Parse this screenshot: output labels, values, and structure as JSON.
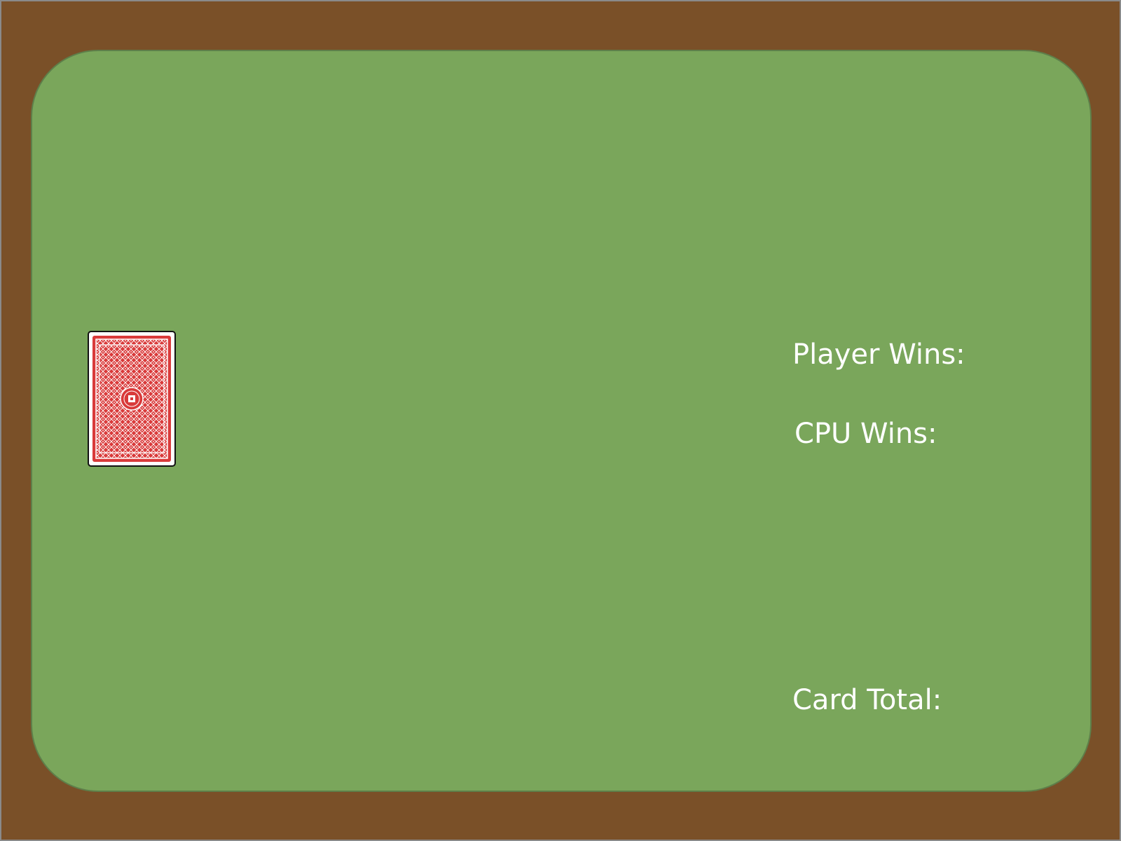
{
  "colors": {
    "frame": "#7a5028",
    "felt": "#7aa65b",
    "card_back": "#d93a3a",
    "label_text": "#ffffff"
  },
  "deck": {
    "icon": "card-back-icon"
  },
  "scoreboard": {
    "player_wins_label": "Player Wins:",
    "cpu_wins_label": "CPU Wins:"
  },
  "hand": {
    "card_total_label": "Card Total:"
  }
}
